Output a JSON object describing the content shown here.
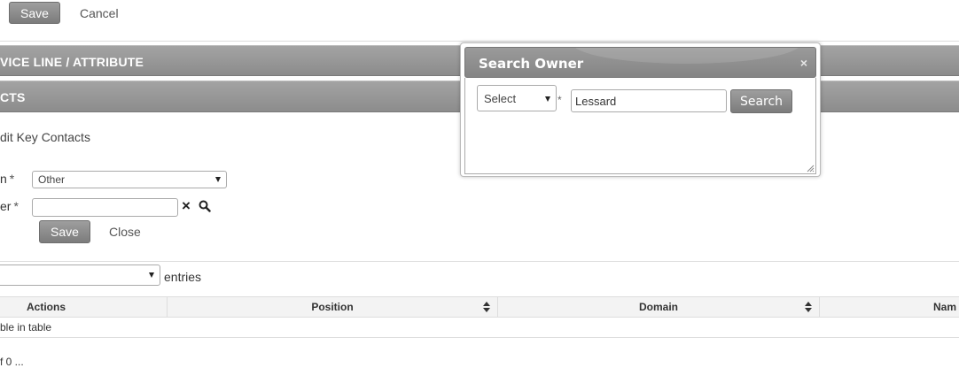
{
  "toolbar": {
    "save_label": "Save",
    "cancel_label": "Cancel"
  },
  "sections": {
    "service_line": "VICE LINE / ATTRIBUTE",
    "contacts": "CTS"
  },
  "form": {
    "subtitle": "dit Key Contacts",
    "domain_label": "n",
    "domain_value": "Other",
    "owner_label": "er",
    "required_mark": "*",
    "owner_value": "",
    "save_label": "Save",
    "close_label": "Close",
    "clear_icon": "×",
    "search_icon": "magnifier"
  },
  "table": {
    "entries_label": "entries",
    "columns": [
      "Actions",
      "Position",
      "Domain",
      "Nam"
    ],
    "empty_message": "ble in table",
    "info_text": "f 0 ..."
  },
  "modal": {
    "title": "Search Owner",
    "close_glyph": "×",
    "select_value": "Select",
    "required_mark": "*",
    "search_value": "Lessard",
    "search_button": "Search"
  }
}
